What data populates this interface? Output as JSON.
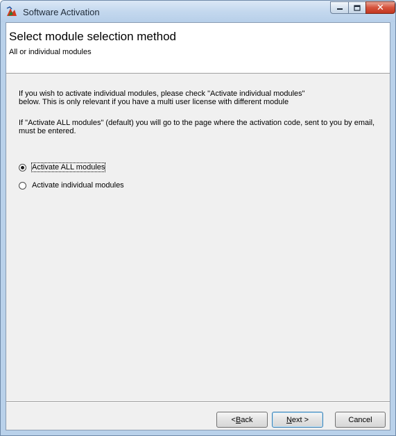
{
  "window": {
    "title": "Software Activation",
    "controls": [
      "minimize-icon",
      "maximize-icon",
      "close-icon"
    ]
  },
  "header": {
    "title": "Select module selection method",
    "subtitle": "All or individual modules"
  },
  "content": {
    "paragraph1_line1": "If you wish to activate individual modules, please check \"Activate individual modules\"",
    "paragraph1_line2": "below. This is only relevant if you have a multi user license with different module",
    "paragraph2_line1": "If \"Activate ALL modules\" (default) you will go to the page where the activation code, sent to you by email,",
    "paragraph2_line2": "must be entered.",
    "options": [
      {
        "label": "Activate ALL modules",
        "selected": true
      },
      {
        "label": "Activate individual modules",
        "selected": false
      }
    ]
  },
  "buttons": {
    "back_prefix": "< ",
    "back_mnemonic": "B",
    "back_rest": "ack",
    "next_mnemonic": "N",
    "next_rest": "ext >",
    "cancel": "Cancel"
  }
}
